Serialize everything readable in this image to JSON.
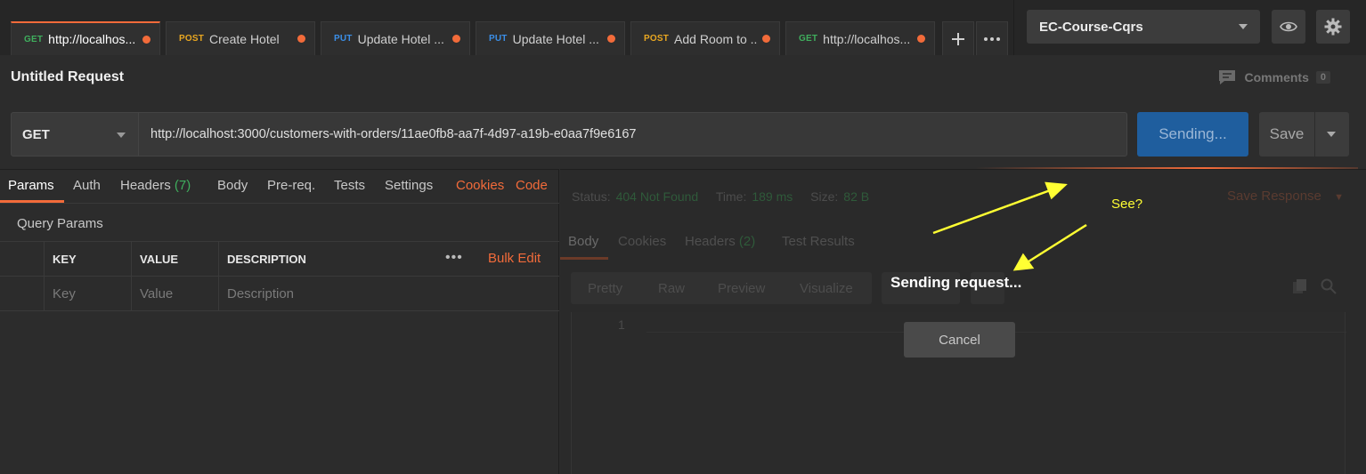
{
  "tabs": [
    {
      "method": "GET",
      "name": "http://localhos...",
      "active": true
    },
    {
      "method": "POST",
      "name": "Create Hotel",
      "active": false
    },
    {
      "method": "PUT",
      "name": "Update Hotel ...",
      "active": false
    },
    {
      "method": "PUT",
      "name": "Update Hotel ...",
      "active": false
    },
    {
      "method": "POST",
      "name": "Add Room to ...",
      "active": false
    },
    {
      "method": "GET",
      "name": "http://localhos...",
      "active": false
    }
  ],
  "tab_actions": {
    "add_icon": "plus-icon",
    "more_icon": "more-icon"
  },
  "environment": {
    "selected": "EC-Course-Cqrs",
    "eye_icon": "eye-icon",
    "settings_icon": "gear-icon"
  },
  "request": {
    "title": "Untitled Request",
    "comments_label": "Comments",
    "comments_count": "0",
    "method": "GET",
    "url": "http://localhost:3000/customers-with-orders/11ae0fb8-aa7f-4d97-a19b-e0aa7f9e6167",
    "send_label": "Sending...",
    "save_label": "Save"
  },
  "request_tabs": {
    "params": "Params",
    "auth": "Auth",
    "headers": "Headers",
    "headers_count": "(7)",
    "body": "Body",
    "prereq": "Pre-req.",
    "tests": "Tests",
    "settings": "Settings",
    "cookies": "Cookies",
    "code": "Code"
  },
  "query_params": {
    "label": "Query Params",
    "columns": [
      "KEY",
      "VALUE",
      "DESCRIPTION"
    ],
    "bulk_edit": "Bulk Edit",
    "placeholders": {
      "key": "Key",
      "value": "Value",
      "description": "Description"
    }
  },
  "response": {
    "status_label": "Status:",
    "status_value": "404 Not Found",
    "time_label": "Time:",
    "time_value": "189 ms",
    "size_label": "Size:",
    "size_value": "82 B",
    "save_response": "Save Response",
    "tabs": {
      "body": "Body",
      "cookies": "Cookies",
      "headers": "Headers",
      "headers_count": "(2)",
      "test_results": "Test Results"
    },
    "formats": [
      "Pretty",
      "Raw",
      "Preview",
      "Visualize"
    ],
    "line_number": "1",
    "sending_text": "Sending request...",
    "cancel_label": "Cancel"
  },
  "annotation": {
    "text": "See?",
    "color": "#ffff33"
  },
  "colors": {
    "accent": "#f26b3a",
    "get": "#3fae5d",
    "post": "#e9a721",
    "put": "#3b8fe8",
    "send": "#1f5e9e"
  }
}
